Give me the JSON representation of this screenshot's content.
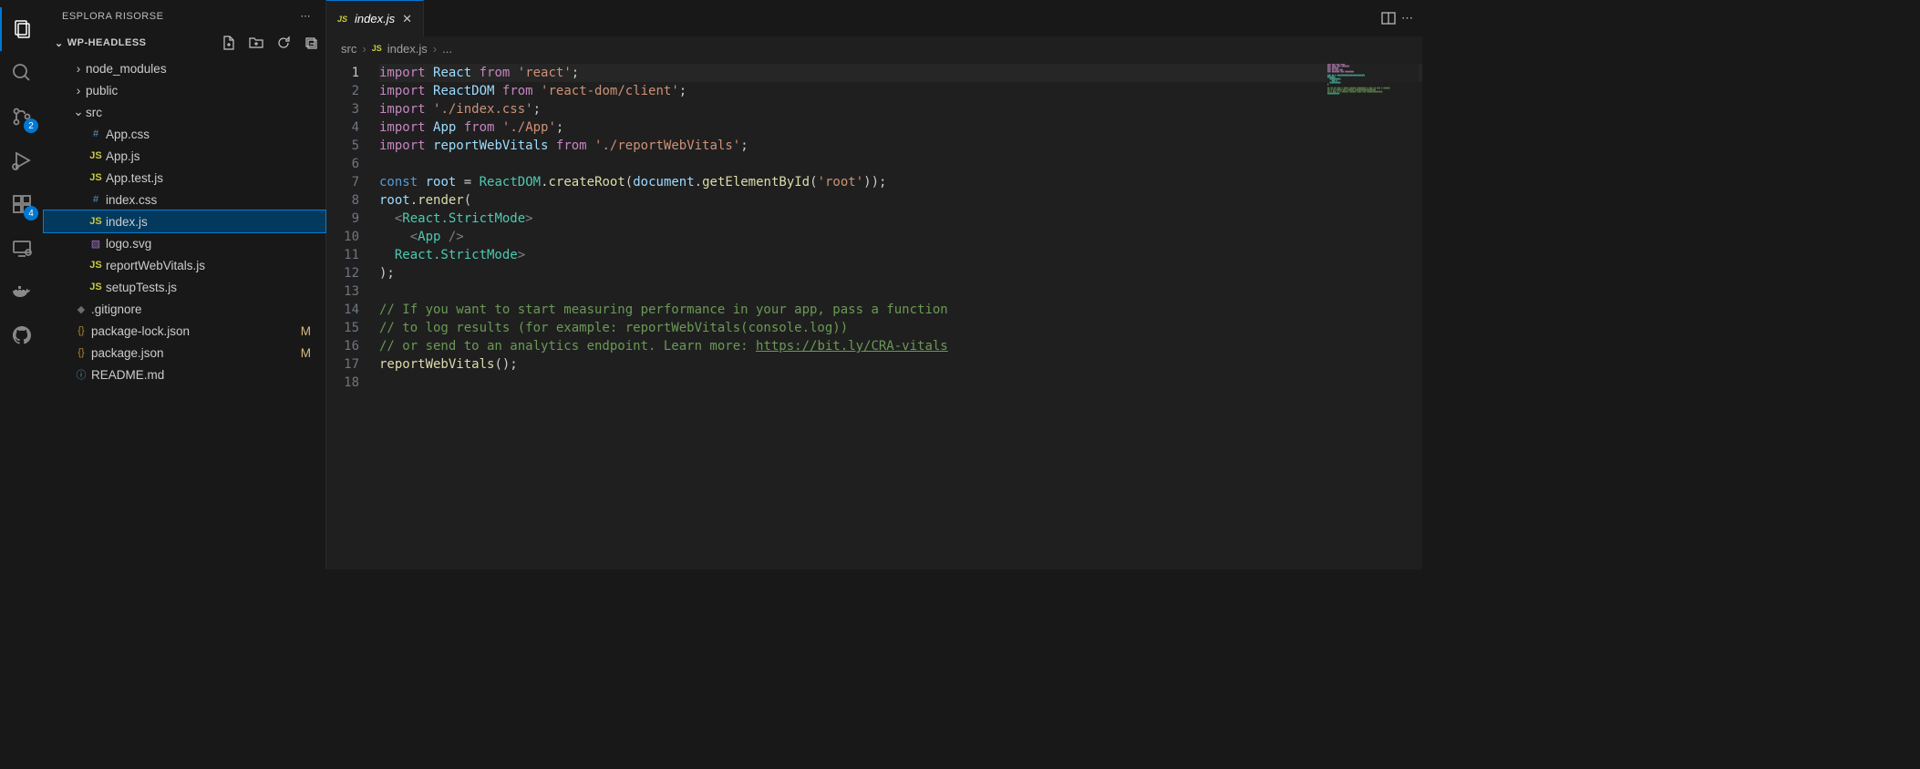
{
  "activityBar": {
    "badges": {
      "scm": "2",
      "extensions": "4"
    }
  },
  "sidebar": {
    "title": "ESPLORA RISORSE",
    "folder": "WP-HEADLESS",
    "tree": [
      {
        "name": "node_modules",
        "type": "folder",
        "depth": 1,
        "expanded": false
      },
      {
        "name": "public",
        "type": "folder",
        "depth": 1,
        "expanded": false
      },
      {
        "name": "src",
        "type": "folder",
        "depth": 1,
        "expanded": true
      },
      {
        "name": "App.css",
        "type": "css",
        "depth": 2
      },
      {
        "name": "App.js",
        "type": "js",
        "depth": 2
      },
      {
        "name": "App.test.js",
        "type": "js",
        "depth": 2
      },
      {
        "name": "index.css",
        "type": "css",
        "depth": 2
      },
      {
        "name": "index.js",
        "type": "js",
        "depth": 2,
        "selected": true
      },
      {
        "name": "logo.svg",
        "type": "svg",
        "depth": 2
      },
      {
        "name": "reportWebVitals.js",
        "type": "js",
        "depth": 2
      },
      {
        "name": "setupTests.js",
        "type": "js",
        "depth": 2
      },
      {
        "name": ".gitignore",
        "type": "git",
        "depth": 1
      },
      {
        "name": "package-lock.json",
        "type": "json",
        "depth": 1,
        "status": "M"
      },
      {
        "name": "package.json",
        "type": "json",
        "depth": 1,
        "status": "M"
      },
      {
        "name": "README.md",
        "type": "info",
        "depth": 1
      }
    ]
  },
  "tabs": {
    "active": {
      "name": "index.js",
      "icon": "JS"
    }
  },
  "breadcrumb": {
    "parts": [
      "src",
      "index.js",
      "..."
    ]
  },
  "code": {
    "lines": 18,
    "content": {
      "l1": {
        "a": "import",
        "b": "React",
        "c": "from",
        "d": "'react'",
        "e": ";"
      },
      "l2": {
        "a": "import",
        "b": "ReactDOM",
        "c": "from",
        "d": "'react-dom/client'",
        "e": ";"
      },
      "l3": {
        "a": "import",
        "d": "'./index.css'",
        "e": ";"
      },
      "l4": {
        "a": "import",
        "b": "App",
        "c": "from",
        "d": "'./App'",
        "e": ";"
      },
      "l5": {
        "a": "import",
        "b": "reportWebVitals",
        "c": "from",
        "d": "'./reportWebVitals'",
        "e": ";"
      },
      "l7": {
        "a": "const",
        "b": "root",
        "c": "=",
        "d": "ReactDOM",
        "e": ".",
        "f": "createRoot",
        "g": "(",
        "h": "document",
        "i": ".",
        "j": "getElementById",
        "k": "(",
        "l": "'root'",
        "m": "));"
      },
      "l8": {
        "a": "root",
        "b": ".",
        "c": "render",
        "d": "("
      },
      "l9": {
        "a": "<",
        "b": "React.StrictMode",
        "c": ">"
      },
      "l10": {
        "a": "<",
        "b": "App",
        "c": " />"
      },
      "l11": {
        "a": "</",
        "b": "React.StrictMode",
        "c": ">"
      },
      "l12": {
        "a": ");"
      },
      "l14": "// If you want to start measuring performance in your app, pass a function",
      "l15": "// to log results (for example: reportWebVitals(console.log))",
      "l16": {
        "a": "// or send to an analytics endpoint. Learn more: ",
        "b": "https://bit.ly/CRA-vitals"
      },
      "l17": {
        "a": "reportWebVitals",
        "b": "();"
      }
    }
  }
}
